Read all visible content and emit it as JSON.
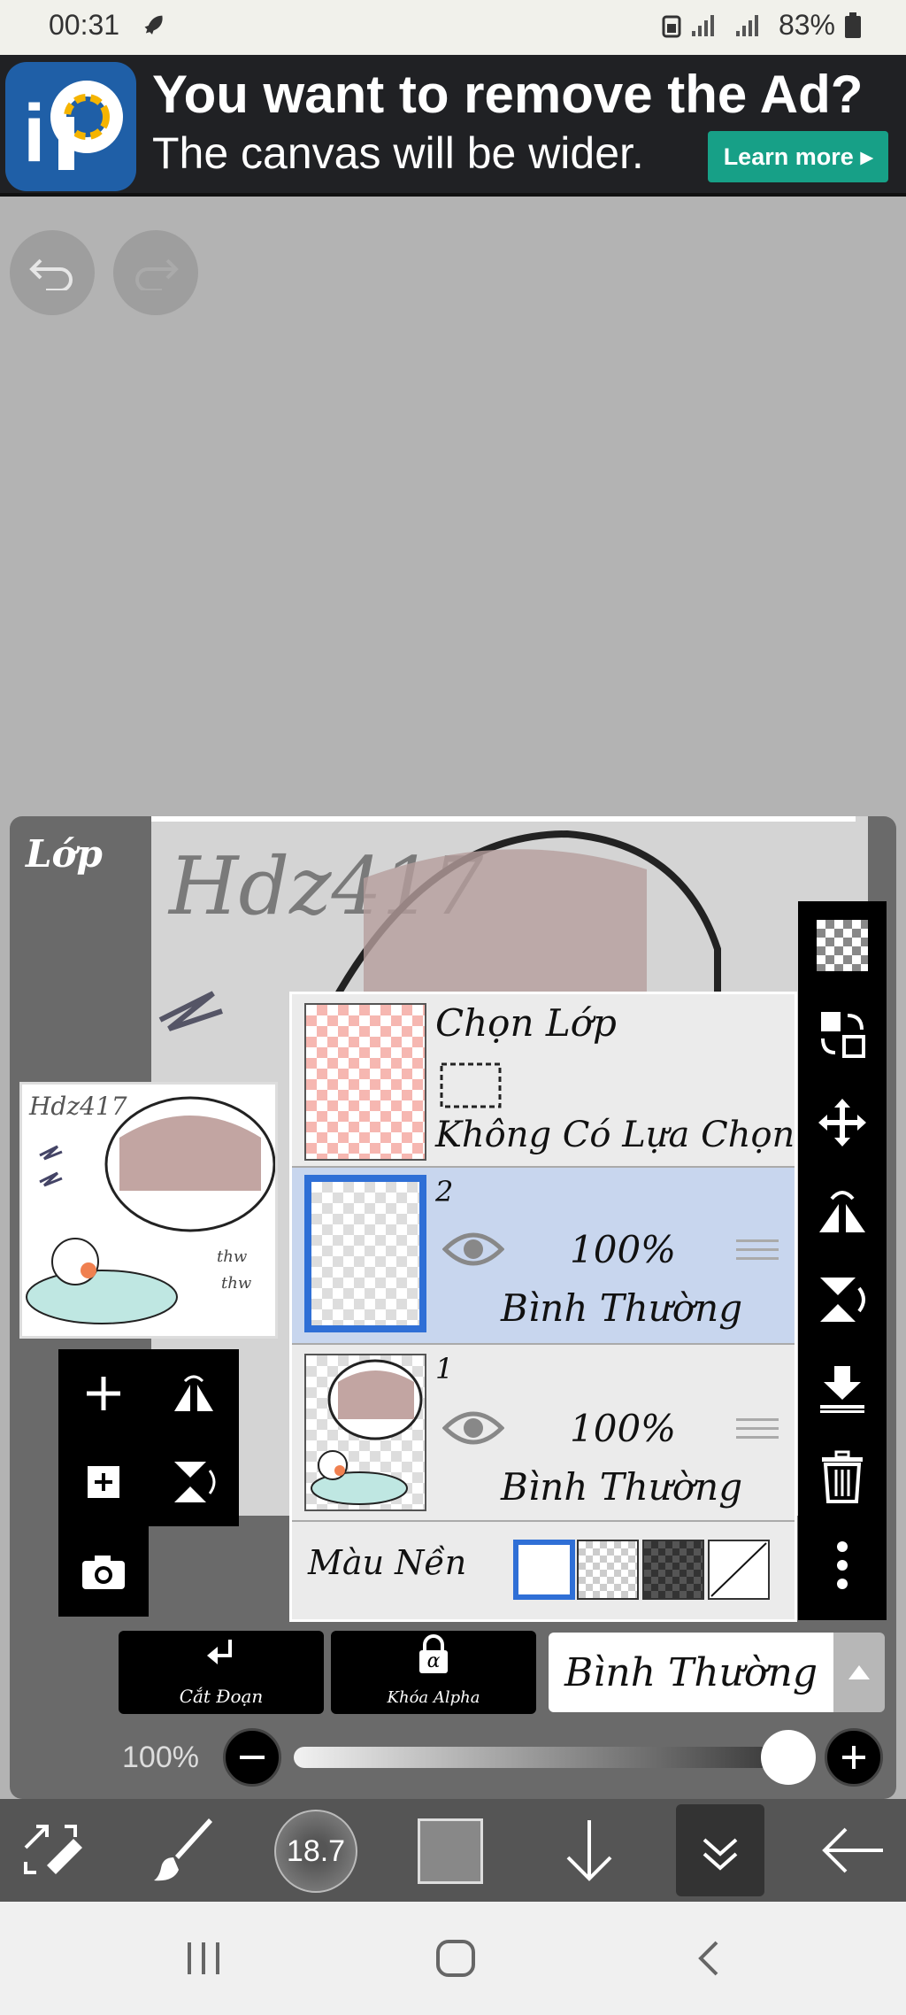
{
  "status_bar": {
    "time": "00:31",
    "battery": "83%"
  },
  "ad": {
    "title": "You want to remove the Ad?",
    "subtitle": "The canvas will be wider.",
    "cta": "Learn more"
  },
  "layer_panel": {
    "title": "Lớp",
    "selection_row": {
      "title": "Chọn Lớp",
      "subtitle": "Không Có Lựa Chọn"
    },
    "layers": [
      {
        "number": "2",
        "opacity": "100%",
        "blend": "Bình Thường",
        "selected": true
      },
      {
        "number": "1",
        "opacity": "100%",
        "blend": "Bình Thường",
        "selected": false
      }
    ],
    "background_label": "Màu Nền"
  },
  "bottom_controls": {
    "clipping_label": "Cắt Đoạn",
    "alpha_lock_label": "Khóa Alpha",
    "alpha_symbol": "α",
    "blend_mode": "Bình Thường",
    "opacity_label": "100%",
    "opacity": 1.0
  },
  "toolbar": {
    "brush_size": "18.7",
    "color": "#888888"
  },
  "icons": {
    "undo": "undo-icon",
    "redo": "redo-icon",
    "add_layer": "plus-icon",
    "add_layer_copy": "add-layer-icon",
    "flip_h": "flip-horizontal-icon",
    "flip_v": "flip-vertical-icon",
    "camera": "camera-icon",
    "transparent": "checker-icon",
    "move_layer": "swap-layers-icon",
    "move": "move-icon",
    "merge_down": "merge-down-icon",
    "delete": "trash-icon",
    "more": "more-vertical-icon"
  }
}
